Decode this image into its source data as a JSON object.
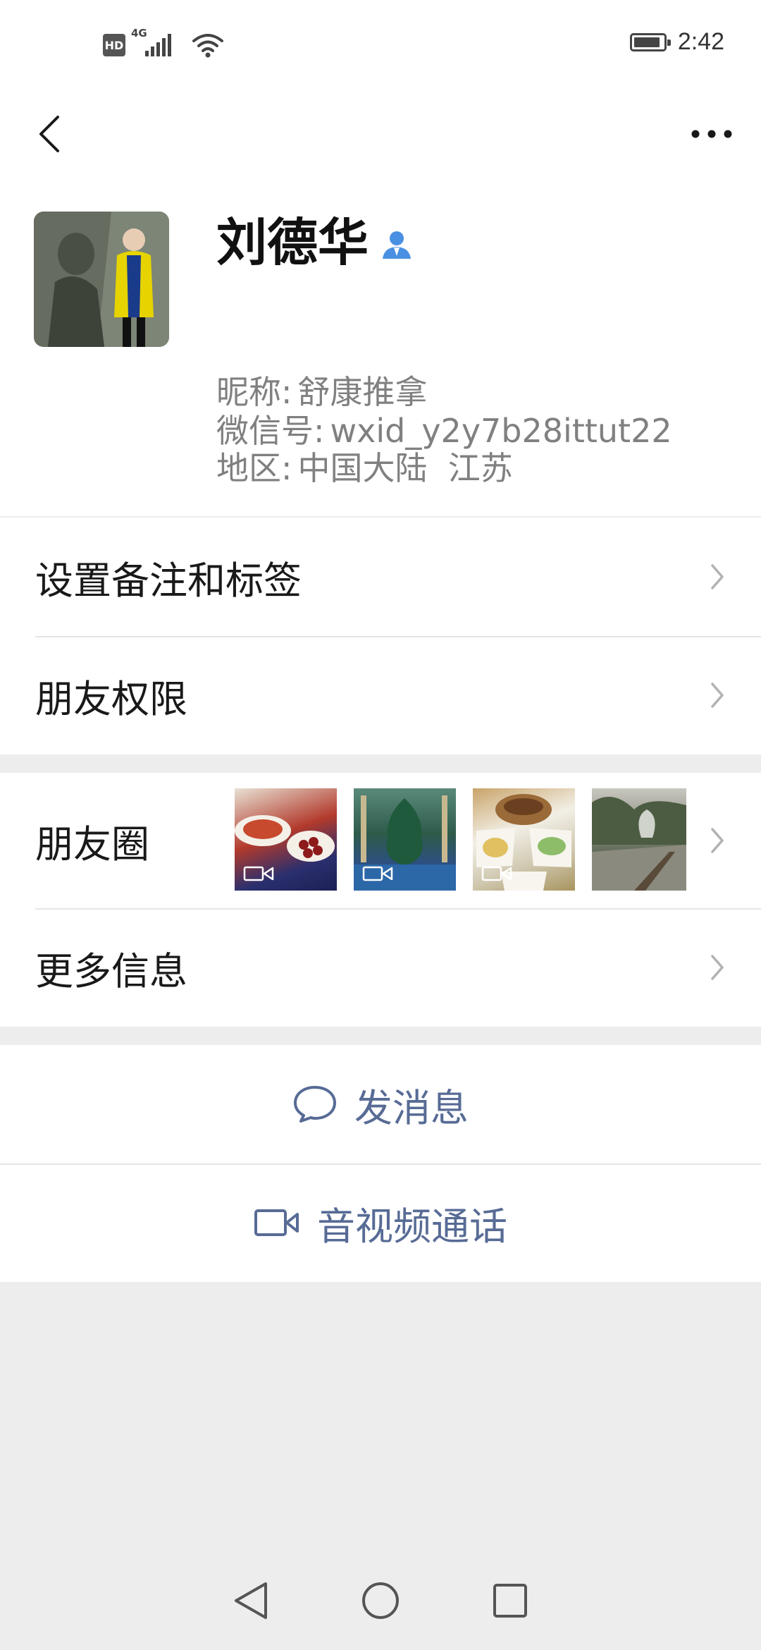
{
  "status_bar": {
    "network": "4G",
    "hd": "HD",
    "time": "2:42"
  },
  "profile": {
    "name": "刘德华",
    "nickname_label": "昵称:",
    "nickname": "舒康推拿",
    "wechat_id_label": "微信号:",
    "wechat_id": "wxid_y2y7b28ittut22",
    "region_label": "地区:",
    "region": "中国大陆  江苏"
  },
  "menu": {
    "remark_tags": "设置备注和标签",
    "permissions": "朋友权限",
    "moments": "朋友圈",
    "more_info": "更多信息"
  },
  "actions": {
    "send_message": "发消息",
    "av_call": "音视频通话"
  },
  "colors": {
    "accent_link": "#576b95",
    "background": "#ededed",
    "contact_icon": "#4a90e2"
  },
  "icons": {
    "back": "back-arrow-icon",
    "more": "more-dots-icon",
    "contact": "contact-person-icon",
    "chat": "chat-bubble-icon",
    "video": "video-camera-icon"
  }
}
